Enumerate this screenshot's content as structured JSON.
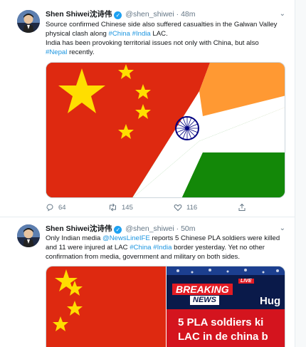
{
  "tweets": [
    {
      "author_name": "Shen Shiwei沈诗伟",
      "author_handle": "@shen_shiwei",
      "separator": "·",
      "time": "48m",
      "text_line1_a": "Source confirmed Chinese side also suffered casualties in the Galwan Valley",
      "text_line2_a": "physical clash along ",
      "tag_china": "#China",
      "tag_india": "#India",
      "text_line2_b": " LAC.",
      "text_line3": "India has been provoking territorial issues not only with China, but also",
      "tag_nepal": "#Nepal",
      "text_line4_b": " recently.",
      "replies": "64",
      "retweets": "145",
      "likes": "116"
    },
    {
      "author_name": "Shen Shiwei沈诗伟",
      "author_handle": "@shen_shiwei",
      "separator": "·",
      "time": "50m",
      "text_line1_a": "Only Indian media ",
      "tag_newsline": "@NewsLineIFE",
      "text_line1_b": " reports 5 Chinese PLA soldiers were killed",
      "text_line2_a": "and 11 were injured at LAC ",
      "tag_china": "#China",
      "tag_india": "#India",
      "text_line2_b": " border yesterday. Yet no other",
      "text_line3": "confirmation from media, government and military on both sides.",
      "media_live": "LIVE",
      "media_breaking": "BREAKING",
      "media_news": "NEWS",
      "media_hug": "Hug",
      "media_headline1": "5 PLA soldiers ki",
      "media_headline2": "LAC in de china b"
    }
  ],
  "colors": {
    "link": "#1b95e0",
    "verified": "#1da1f2",
    "muted": "#657786",
    "china_red": "#de2910",
    "china_star": "#ffde00",
    "india_saffron": "#ff9933",
    "india_green": "#138808",
    "india_chakra": "#000080"
  }
}
